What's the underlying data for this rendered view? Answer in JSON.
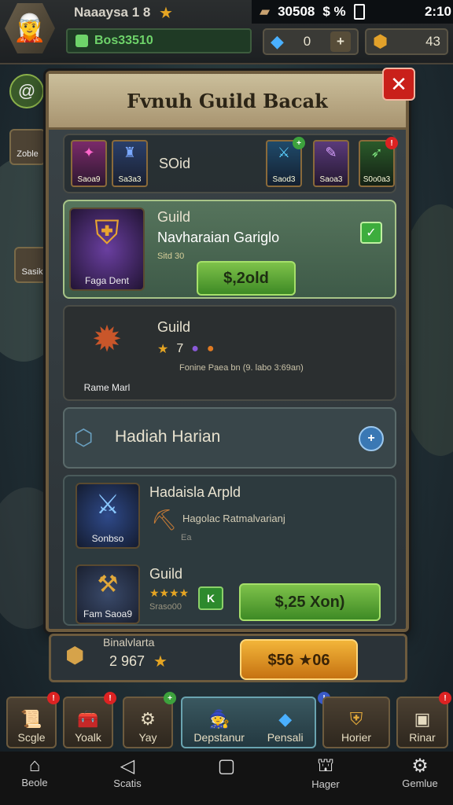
{
  "status_bar": {
    "stat": "30508",
    "signal": "$ %",
    "time": "2:10"
  },
  "player": {
    "name": "Naaaysa 1 8",
    "xp_text": "Bos33510"
  },
  "resources": [
    {
      "value": "0"
    },
    {
      "value": "43"
    }
  ],
  "side_labels": {
    "left_1": "Zoble",
    "left_2": "Sasik"
  },
  "modal": {
    "title": "Fvnuh Guild Bacak",
    "close": "✕",
    "top_tabs": [
      {
        "caption": "Saoa9"
      },
      {
        "caption": "Sa3a3"
      }
    ],
    "top_tabs_label": "SOid",
    "top_right_items": [
      {
        "caption": "Saod3"
      },
      {
        "caption": "Saoa3"
      },
      {
        "caption": "S0o0a3"
      }
    ],
    "guild_1": {
      "icon_caption": "Faga Dent",
      "title": "Guild",
      "name": "Navharaian Gariglo",
      "sub": "Sitd 30",
      "button": "$,2old",
      "check": "✓"
    },
    "guild_2": {
      "icon_caption": "Rame Marl",
      "title": "Guild",
      "stars": "7",
      "desc": "Fonine Paea bn (9. labo 3:69an)"
    },
    "daily": {
      "title": "Hadiah Harian",
      "plus": "+"
    },
    "reward_1": {
      "icon_caption": "Sonbso",
      "title": "Hadaisla Arpld",
      "desc": "Hagolac Ratmalvarianj",
      "note": "Ea"
    },
    "reward_2": {
      "icon_caption": "Fam Saoa9",
      "title": "Guild",
      "stars": "★★★★",
      "sub": "Sraso00",
      "tag": "K",
      "button": "$,25 Xon)"
    }
  },
  "below_modal": {
    "label": "Binalvlarta",
    "value": "2 967",
    "button": "$56 ★06"
  },
  "bottom_tabs": [
    {
      "label": "Scgle"
    },
    {
      "label": "Yoalk"
    },
    {
      "label": "Yay"
    },
    {
      "label": "Depstanur"
    },
    {
      "label": "Pensali"
    },
    {
      "label": "Horier"
    },
    {
      "label": "Rinar"
    }
  ],
  "nav": [
    {
      "label": "Beole"
    },
    {
      "label": "Scatis"
    },
    {
      "label": ""
    },
    {
      "label": "Hager"
    },
    {
      "label": "Gemlue"
    }
  ],
  "colors": {
    "accent_green": "#7ec24a",
    "accent_orange": "#f2b53a",
    "close_red": "#c9201a",
    "frame_gold": "#6d5b3e"
  }
}
